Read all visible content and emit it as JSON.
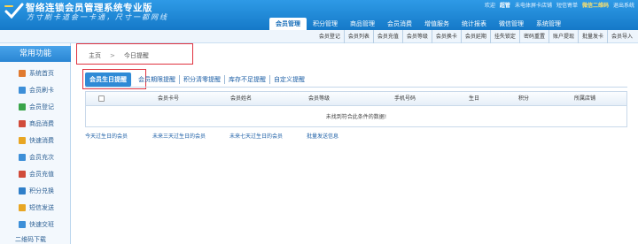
{
  "app": {
    "title": "智络连锁会员管理系统专业版",
    "slogan": "方寸刷卡道会一卡通，尺寸一都网线"
  },
  "top_links": {
    "welcome": "欢迎",
    "user": "超管",
    "shop": "未电体屏卡店铺",
    "sms": "短信寄单",
    "qrcode": "微信二维码",
    "logout": "退出系统"
  },
  "main_nav": [
    "会员管理",
    "积分管理",
    "商品管理",
    "会员消费",
    "增值服务",
    "统计报表",
    "微信管理",
    "系统管理"
  ],
  "sub_nav": [
    "会员登记",
    "会员列表",
    "会员充值",
    "会员等级",
    "会员换卡",
    "会员延期",
    "挂失锁定",
    "密码重置",
    "账户提现",
    "批量发卡",
    "会员导入"
  ],
  "sidebar": {
    "title": "常用功能",
    "items": [
      {
        "label": "系统首页",
        "color": "#e07a2f"
      },
      {
        "label": "会员刷卡",
        "color": "#3d8fd8"
      },
      {
        "label": "会员登记",
        "color": "#3aa54a"
      },
      {
        "label": "商品消费",
        "color": "#d14b3a"
      },
      {
        "label": "快速消费",
        "color": "#e8a623"
      },
      {
        "label": "会员充次",
        "color": "#3d8fd8"
      },
      {
        "label": "会员充值",
        "color": "#d14b3a"
      },
      {
        "label": "积分兑换",
        "color": "#2f7fc9"
      },
      {
        "label": "短信发送",
        "color": "#e8a623"
      },
      {
        "label": "快速交班",
        "color": "#3d8fd8"
      },
      {
        "label": "二维码下载",
        "color": "#555555"
      }
    ]
  },
  "breadcrumb": {
    "home": "主页",
    "sep": ">",
    "current": "今日提醒"
  },
  "content_tabs": [
    "会员生日提醒",
    "会员期限提醒",
    "积分清零提醒",
    "库存不足提醒",
    "自定义提醒"
  ],
  "table": {
    "columns": [
      "会员卡号",
      "会员姓名",
      "会员等级",
      "手机号码",
      "生日",
      "积分",
      "所属店铺"
    ],
    "empty_message": "未找到符合此条件的数据!"
  },
  "footer_links": [
    "今天过生日的会员",
    "未来三天过生日的会员",
    "未来七天过生日的会员",
    "批量发送信息"
  ],
  "colors": {
    "header_top": "#2e9ae6",
    "header_bottom": "#1579c8",
    "highlight": "#e0323f",
    "link": "#1d5fa6"
  }
}
